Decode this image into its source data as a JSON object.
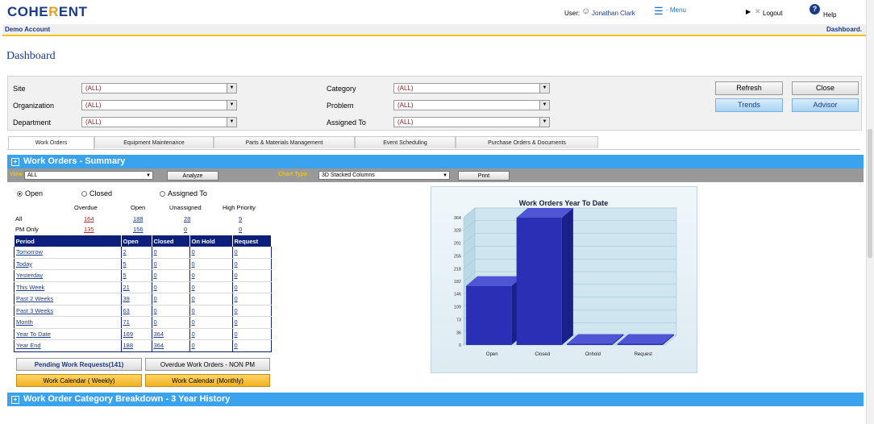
{
  "header": {
    "logo_text": "COHE",
    "logo_sep": "R",
    "logo_text2": "ENT",
    "user_label": "User:",
    "user_name": "Jonathan Clark",
    "menu_label": "- Menu",
    "logout": "Logout",
    "help": "Help",
    "account": "Demo Account",
    "location": "Dashboard."
  },
  "page_title": "Dashboard",
  "filters": {
    "site_label": "Site",
    "site_value": "(ALL)",
    "org_label": "Organization",
    "org_value": "(ALL)",
    "dept_label": "Department",
    "dept_value": "(ALL)",
    "category_label": "Category",
    "category_value": "(ALL)",
    "problem_label": "Problem",
    "problem_value": "(ALL)",
    "assigned_label": "Assigned To",
    "assigned_value": "(ALL)"
  },
  "buttons": {
    "refresh": "Refresh",
    "close": "Close",
    "trends": "Trends",
    "advisor": "Advisor"
  },
  "tabs": [
    "Work Orders",
    "Equipment Maintenance",
    "Parts & Materials Management",
    "Event Scheduling",
    "Purchase Orders & Documents"
  ],
  "summary_section": {
    "title": "Work Orders - Summary",
    "expander": "+",
    "view_label": "View",
    "view_value": "ALL",
    "analyze": "Analyze",
    "chart_type_label": "Chart Type",
    "chart_type_value": "3D Stacked Columns",
    "print": "Print"
  },
  "radios": [
    {
      "label": "Open",
      "selected": true
    },
    {
      "label": "Closed",
      "selected": false
    },
    {
      "label": "Assigned To",
      "selected": false
    }
  ],
  "summary": {
    "headers": [
      "Overdue",
      "Open",
      "Unassigned",
      "High Priority"
    ],
    "rows": [
      {
        "label": "All",
        "values": [
          "164",
          "188",
          "28",
          "9"
        ]
      },
      {
        "label": "PM Only",
        "values": [
          "135",
          "156",
          "0",
          "0"
        ]
      }
    ]
  },
  "period_table": {
    "headers": [
      "Period",
      "Open",
      "Closed",
      "On Hold",
      "Request"
    ],
    "rows": [
      [
        "Tomorrow",
        "2",
        "0",
        "0",
        "0"
      ],
      [
        "Today",
        "5",
        "0",
        "0",
        "0"
      ],
      [
        "Yesterday",
        "5",
        "0",
        "0",
        "0"
      ],
      [
        "This Week",
        "21",
        "0",
        "0",
        "0"
      ],
      [
        "Past 2 Weeks",
        "39",
        "0",
        "0",
        "0"
      ],
      [
        "Past 3 Weeks",
        "63",
        "0",
        "0",
        "0"
      ],
      [
        "Month",
        "71",
        "0",
        "0",
        "0"
      ],
      [
        "Year To Date",
        "169",
        "364",
        "0",
        "0"
      ],
      [
        "Year End",
        "188",
        "364",
        "0",
        "0"
      ]
    ]
  },
  "bottom_buttons": {
    "pending": "Pending Work Requests(141)",
    "overdue": "Overdue Work Orders - NON PM",
    "weekly": "Work Calendar ( Weekly)",
    "monthly": "Work Calendar (Monthly)"
  },
  "category_section": {
    "title": "Work Order Category Breakdown - 3 Year History",
    "expander": "+"
  },
  "chart_data": {
    "type": "bar",
    "title": "Work Orders Year To Date",
    "categories": [
      "Open",
      "Closed",
      "Onhold",
      "Request"
    ],
    "values": [
      169,
      364,
      0,
      0
    ],
    "yticks": [
      "0",
      "36",
      "73",
      "109",
      "146",
      "182",
      "218",
      "255",
      "291",
      "328",
      "364"
    ],
    "ylim": [
      0,
      364
    ],
    "xlabel": "",
    "ylabel": "",
    "bar_color": "#2a2fb5"
  }
}
